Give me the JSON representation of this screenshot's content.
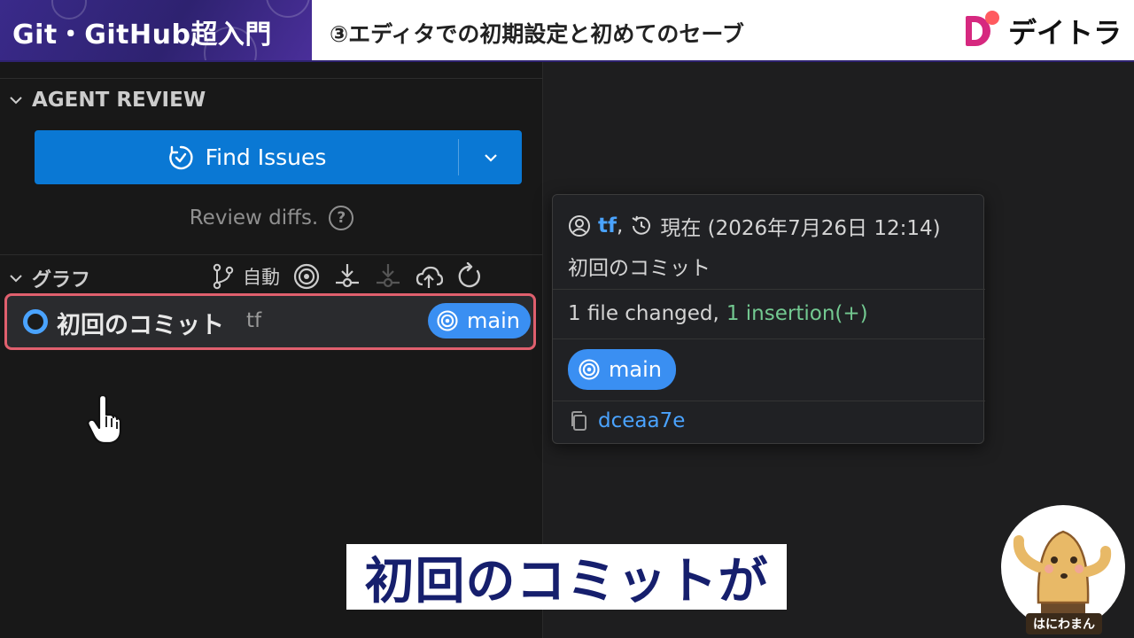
{
  "banner": {
    "course_title": "Git・GitHub超入門",
    "lesson_title": "③エディタでの初期設定と初めてのセーブ",
    "brand_name": "デイトラ",
    "colors": {
      "brand_left": "#2e2270",
      "logo_pink": "#d6287f",
      "logo_dot": "#ff5a5f"
    }
  },
  "agent_review": {
    "title": "AGENT REVIEW",
    "find_issues_label": "Find Issues",
    "hint": "Review diffs.",
    "help_icon": "?"
  },
  "graph": {
    "title": "グラフ",
    "auto_label": "自動",
    "commit": {
      "message": "初回のコミット",
      "author": "tf",
      "branch": "main"
    }
  },
  "hover_card": {
    "author": "tf",
    "separator": ",",
    "time": "現在 (2026年7月26日 12:14)",
    "message": "初回のコミット",
    "files_changed": "1 file changed,",
    "insertions": "1 insertion(+)",
    "branch": "main",
    "hash": "dceaa7e"
  },
  "subtitle": "初回のコミットが",
  "avatar_label": "はにわまん",
  "colors": {
    "accent_blue": "#0a78d4",
    "branch_blue": "#3a8ff2",
    "highlight_red": "#e0606e",
    "insert_green": "#73c991"
  }
}
